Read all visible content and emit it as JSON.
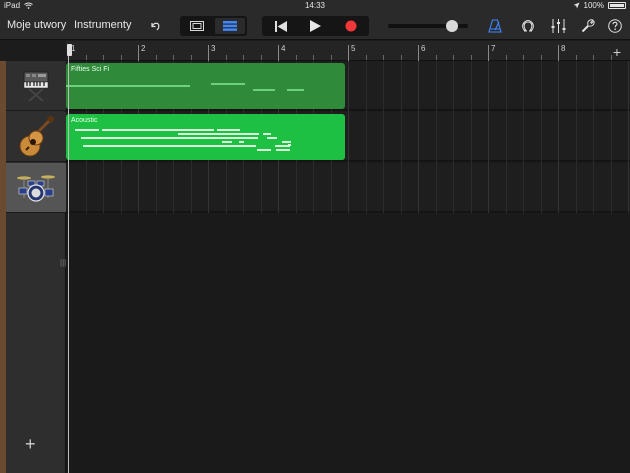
{
  "status_bar": {
    "device": "iPad",
    "time": "14:33",
    "battery": "100%"
  },
  "toolbar": {
    "my_songs": "Moje utwory",
    "instruments": "Instrumenty",
    "volume_level": 0.85
  },
  "ruler": {
    "bars": [
      "1",
      "2",
      "3",
      "4",
      "5",
      "6",
      "7",
      "8"
    ]
  },
  "tracks": [
    {
      "name": "keyboard",
      "icon": "synth-keyboard-icon",
      "region_label": "Fifties Sci Fi",
      "region_color": "#2f8a3a"
    },
    {
      "name": "guitar",
      "icon": "acoustic-guitar-icon",
      "region_label": "Acoustic",
      "region_color": "#1ec043"
    },
    {
      "name": "drums",
      "icon": "drum-kit-icon",
      "region_label": "",
      "region_color": ""
    }
  ]
}
